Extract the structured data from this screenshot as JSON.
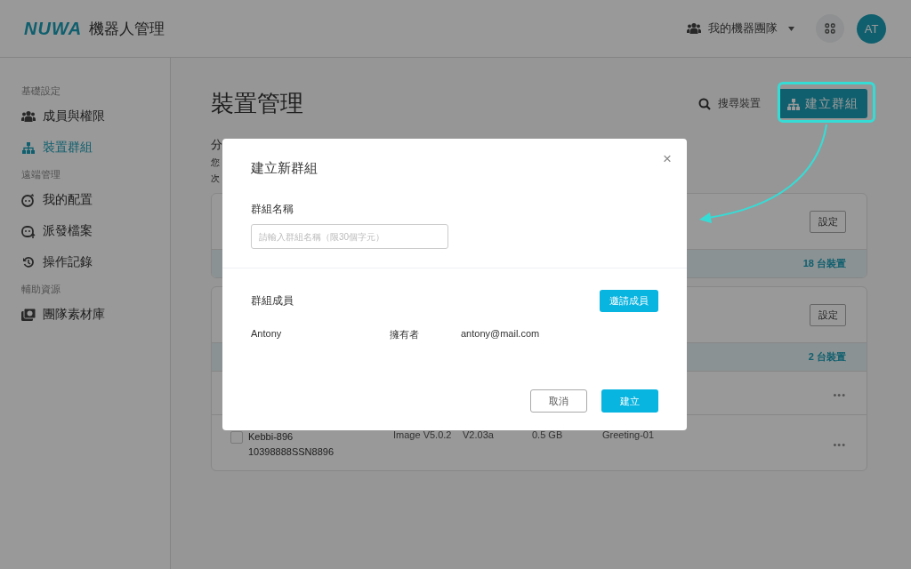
{
  "header": {
    "logo": "NUWA",
    "title": "機器人管理",
    "team": "我的機器團隊",
    "avatar": "AT"
  },
  "sidebar": {
    "sections": [
      {
        "label": "基礎設定",
        "items": [
          {
            "label": "成員與權限",
            "selected": false
          },
          {
            "label": "裝置群組",
            "selected": true
          }
        ]
      },
      {
        "label": "遠端管理",
        "items": [
          {
            "label": "我的配置",
            "selected": false
          },
          {
            "label": "派發檔案",
            "selected": false
          },
          {
            "label": "操作記錄",
            "selected": false
          }
        ]
      },
      {
        "label": "輔助資源",
        "items": [
          {
            "label": "團隊素材庫",
            "selected": false
          }
        ]
      }
    ]
  },
  "page": {
    "title": "裝置管理",
    "search": "搜尋裝置",
    "create_button": "建立群組",
    "subtitle": "分",
    "notes": [
      "您",
      "次"
    ]
  },
  "groups": [
    {
      "settings": "設定",
      "count": "18 台裝置"
    },
    {
      "settings": "設定",
      "count": "2 台裝置",
      "rows": [
        {
          "menu": "•••"
        },
        {
          "checked": false,
          "name": "Kebbi-896",
          "serial": "10398888SSN8896",
          "image": "Image V5.0.2",
          "version": "V2.03a",
          "size": "0.5 GB",
          "greeting": "Greeting-01",
          "menu": "•••"
        }
      ]
    }
  ],
  "modal": {
    "title": "建立新群組",
    "close": "×",
    "name_label": "群組名稱",
    "name_placeholder": "請輸入群組名稱（限30個字元）",
    "members_label": "群組成員",
    "invite": "邀請成員",
    "members": [
      {
        "name": "Antony",
        "role": "擁有者",
        "email": "antony@mail.com"
      }
    ],
    "cancel": "取消",
    "confirm": "建立"
  }
}
